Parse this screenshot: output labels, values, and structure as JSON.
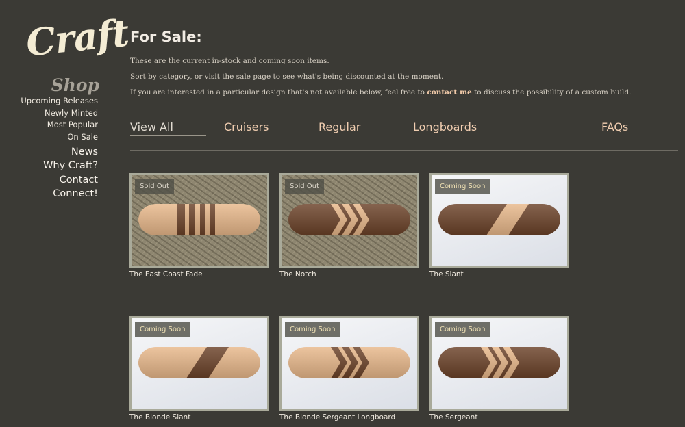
{
  "brand": {
    "logo_text": "Craft"
  },
  "sidebar": {
    "section_title": "Shop",
    "sub_items": [
      {
        "label": "Upcoming Releases"
      },
      {
        "label": "Newly Minted"
      },
      {
        "label": "Most Popular"
      },
      {
        "label": "On Sale"
      }
    ],
    "main_items": [
      {
        "label": "News"
      },
      {
        "label": "Why Craft?"
      },
      {
        "label": "Contact"
      },
      {
        "label": "Connect!"
      }
    ]
  },
  "page": {
    "title": "For Sale:",
    "intro_line1": "These are the current in-stock and coming soon items.",
    "intro_line2": "Sort by category, or visit the sale page to see what's being discounted at the moment.",
    "intro_line3_before": "If you are interested in a particular design that's not available below, feel free to",
    "intro_line3_link": "contact me",
    "intro_line3_after": "to discuss the possibility of a custom build."
  },
  "tabs": [
    {
      "label": "View All",
      "active": true
    },
    {
      "label": "Cruisers"
    },
    {
      "label": "Regular"
    },
    {
      "label": "Longboards"
    },
    {
      "label": "FAQs"
    }
  ],
  "products": [
    {
      "name": "The East Coast Fade",
      "badge": "Sold Out",
      "background": "grass",
      "wood": "maple",
      "pattern": "stripes"
    },
    {
      "name": "The Notch",
      "badge": "Sold Out",
      "background": "grass",
      "wood": "walnut",
      "pattern": "chevrons"
    },
    {
      "name": "The Slant",
      "badge": "Coming Soon",
      "background": "sheet",
      "wood": "walnut",
      "pattern": "slant"
    },
    {
      "name": "The Blonde Slant",
      "badge": "Coming Soon",
      "background": "sheet",
      "wood": "maple",
      "pattern": "slant"
    },
    {
      "name": "The Blonde Sergeant Longboard",
      "badge": "Coming Soon",
      "background": "sheet",
      "wood": "maple",
      "pattern": "chevrons"
    },
    {
      "name": "The Sergeant",
      "badge": "Coming Soon",
      "background": "sheet",
      "wood": "walnut",
      "pattern": "chevrons"
    }
  ],
  "colors": {
    "background": "#3b3a35",
    "accent_link": "#f0c9a8",
    "maple": "#e8b88a",
    "walnut": "#6b4128",
    "frame": "#a9aa9a"
  }
}
